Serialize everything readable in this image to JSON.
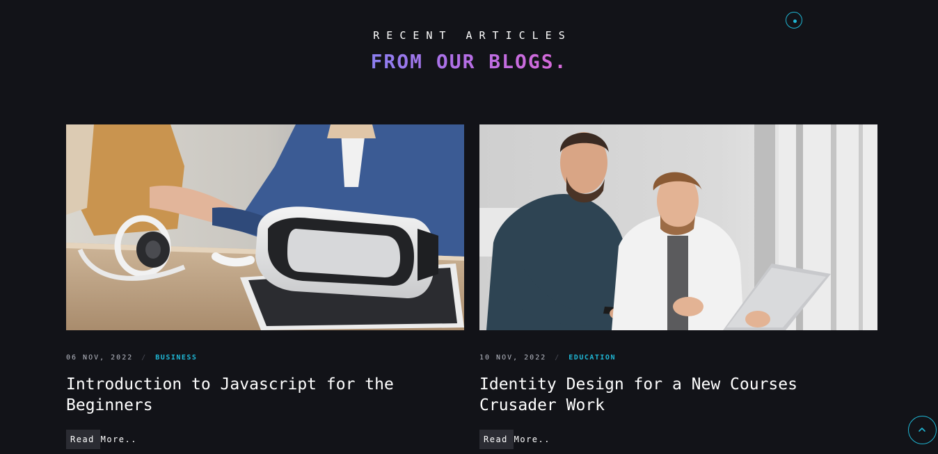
{
  "section": {
    "eyebrow": "RECENT ARTICLES",
    "headline_text": "FROM OUR BLOGS",
    "headline_dot": "."
  },
  "articles": [
    {
      "date": "06 NOV, 2022",
      "separator": "/",
      "category": "BUSINESS",
      "title": "Introduction to Javascript for the Beginners",
      "read_more": "Read More..",
      "image_icon": "vr-headset-photo"
    },
    {
      "date": "10 NOV, 2022",
      "separator": "/",
      "category": "EDUCATION",
      "title": "Identity Design for a New Courses Crusader Work",
      "read_more": "Read More..",
      "image_icon": "colleagues-laptop-photo"
    }
  ],
  "controls": {
    "back_to_top_icon": "chevron-up-icon",
    "cursor_icon": "cursor-ring-icon"
  },
  "colors": {
    "background": "#121318",
    "accent": "#1fb8d6",
    "gradient_start": "#8b7ff0",
    "gradient_end": "#d56ad9"
  }
}
